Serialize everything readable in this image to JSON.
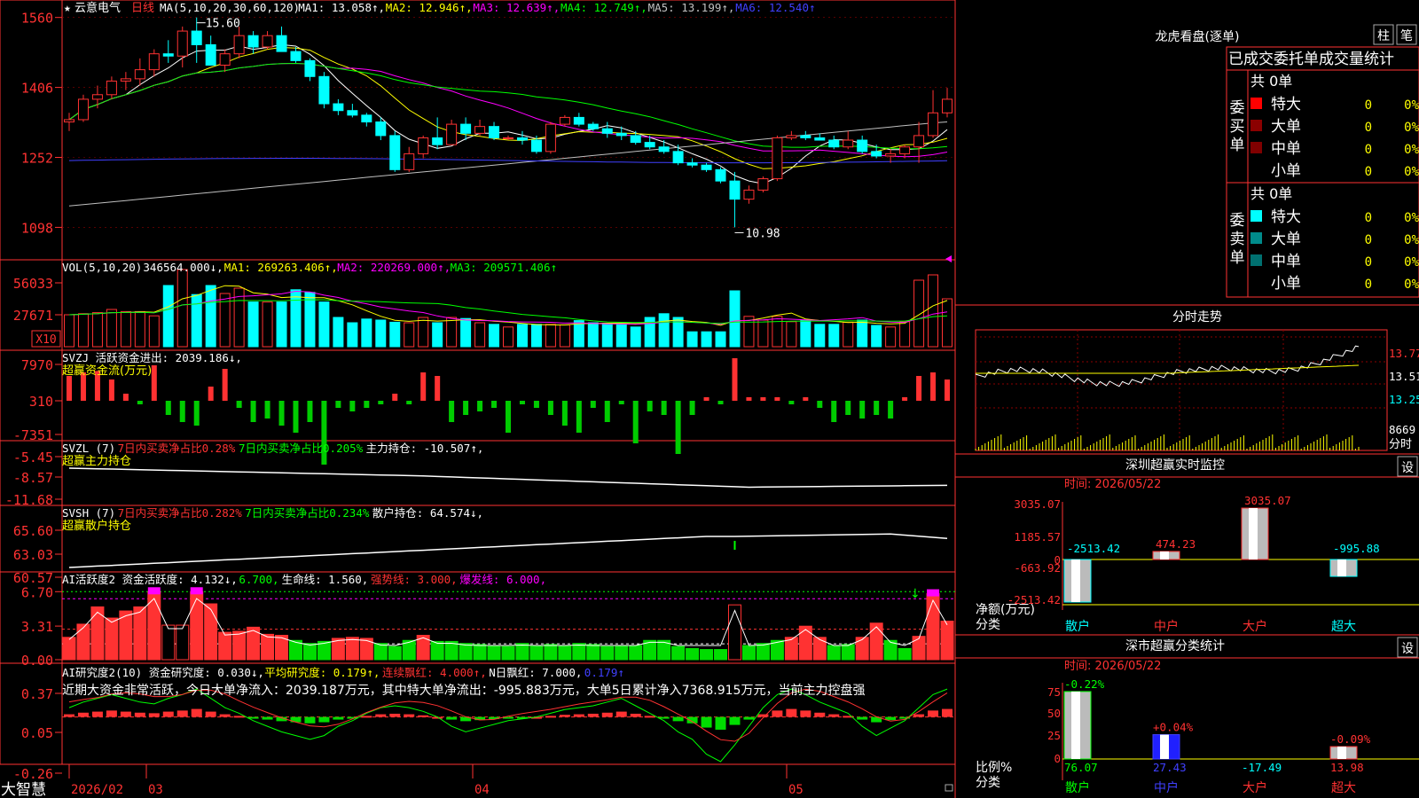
{
  "stock": {
    "star": "★",
    "name": "云意电气",
    "period": "日线"
  },
  "colors": {
    "up": "#ff3232",
    "down": "#00ffff",
    "ma1": "#ffffff",
    "ma2": "#ffff00",
    "ma3": "#ff00ff",
    "ma4": "#00ff00",
    "ma5": "#c0c0c0",
    "ma6": "#4040ff",
    "grid": "#8b0000",
    "axis": "#ff3232",
    "bg": "#000000"
  },
  "panels": {
    "kline": {
      "title_parts": [
        {
          "text": "MA(5,10,20,30,60,120)",
          "color": "#ffffff"
        },
        {
          "text": "MA1: 13.058↑,",
          "color": "#ffffff"
        },
        {
          "text": "MA2: 12.946↑,",
          "color": "#ffff00"
        },
        {
          "text": "MA3: 12.639↑,",
          "color": "#ff00ff"
        },
        {
          "text": "MA4: 12.749↑,",
          "color": "#00ff00"
        },
        {
          "text": "MA5: 13.199↑,",
          "color": "#c0c0c0"
        },
        {
          "text": "MA6: 12.540↑",
          "color": "#4040ff"
        }
      ],
      "y_ticks": [
        "1560",
        "1406",
        "1252",
        "1098"
      ],
      "y_range": [
        10.5,
        15.75
      ],
      "high_label": "15.60",
      "low_label": "10.98"
    },
    "vol": {
      "title_parts": [
        {
          "text": "VOL(5,10,20)",
          "color": "#ffffff"
        },
        {
          "text": "346564.000↓,",
          "color": "#ffffff"
        },
        {
          "text": "MA1: 269263.406↑,",
          "color": "#ffff00"
        },
        {
          "text": "MA2: 220269.000↑,",
          "color": "#ff00ff"
        },
        {
          "text": "MA3: 209571.406↑",
          "color": "#00ff00"
        }
      ],
      "y_ticks": [
        "56033",
        "27671"
      ],
      "unit": "X10"
    },
    "svzj": {
      "title_parts": [
        {
          "text": "SVZJ  活跃资金进出: 2039.186↓,",
          "color": "#ffffff"
        }
      ],
      "subtitle": "超赢资金流(万元)",
      "y_ticks": [
        "7970",
        "310",
        "-7351"
      ]
    },
    "svzl": {
      "title_parts": [
        {
          "text": "SVZL (7)",
          "color": "#ffffff"
        },
        {
          "text": "7日内买卖净占比0.28%",
          "color": "#ff3232"
        },
        {
          "text": "7日内买卖净占比0.205%",
          "color": "#00ff00"
        },
        {
          "text": "主力持仓: -10.507↑,",
          "color": "#ffffff"
        }
      ],
      "subtitle": "超赢主力持仓",
      "y_ticks": [
        "-5.45",
        "-8.57",
        "-11.68"
      ]
    },
    "svsh": {
      "title_parts": [
        {
          "text": "SVSH (7)",
          "color": "#ffffff"
        },
        {
          "text": "7日内买卖净占比0.282%",
          "color": "#ff3232"
        },
        {
          "text": "7日内买卖净占比0.234%",
          "color": "#00ff00"
        },
        {
          "text": "散户持仓: 64.574↓,",
          "color": "#ffffff"
        }
      ],
      "subtitle": "超赢散户持仓",
      "y_ticks": [
        "65.60",
        "63.03",
        "60.57"
      ]
    },
    "active": {
      "title_parts": [
        {
          "text": "AI活跃度2 资金活跃度: 4.132↓,",
          "color": "#ffffff"
        },
        {
          "text": "6.700,",
          "color": "#00ff00"
        },
        {
          "text": "生命线: 1.560,",
          "color": "#ffffff"
        },
        {
          "text": "强势线: 3.000,",
          "color": "#ff3232"
        },
        {
          "text": "爆发线: 6.000,",
          "color": "#ff00ff"
        }
      ],
      "y_ticks": [
        "6.70",
        "3.31",
        "0.00"
      ]
    },
    "research": {
      "title_parts": [
        {
          "text": "AI研究度2(10) 资金研究度: 0.030↓,",
          "color": "#ffffff"
        },
        {
          "text": "平均研究度: 0.179↑,",
          "color": "#ffff00"
        },
        {
          "text": "连续飘红: 4.000↑,",
          "color": "#ff3232"
        },
        {
          "text": "N日飘红: 7.000,",
          "color": "#ffffff"
        },
        {
          "text": "0.179↑",
          "color": "#4040ff"
        }
      ],
      "comment": "近期大资金非常活跃，今日大单净流入：2039.187万元，其中特大单净流出：-995.883万元，大单5日累计净入7368.915万元，当前主力控盘强",
      "y_ticks": [
        "0.37",
        "0.05",
        "-0.26"
      ]
    }
  },
  "x_axis": {
    "brand": "大智慧",
    "labels": [
      "2026/02",
      "03",
      "04",
      "05"
    ]
  },
  "right": {
    "lhb": {
      "title": "龙虎看盘(逐单)",
      "btn_bar": "柱",
      "btn_single": "笔",
      "header": "已成交委托单成交量统计"
    },
    "buy": {
      "vlabel": "委买单",
      "total": "共 0单",
      "rows": [
        {
          "name": "特大",
          "count": "0",
          "pct": "0%",
          "color": "#ff0000"
        },
        {
          "name": "大单",
          "count": "0",
          "pct": "0%",
          "color": "#8b0000"
        },
        {
          "name": "中单",
          "count": "0",
          "pct": "0%",
          "color": "#800000"
        },
        {
          "name": "小单",
          "count": "0",
          "pct": "0%",
          "color": "#000000"
        }
      ]
    },
    "sell": {
      "vlabel": "委卖单",
      "total": "共 0单",
      "rows": [
        {
          "name": "特大",
          "count": "0",
          "pct": "0%",
          "color": "#00ffff"
        },
        {
          "name": "大单",
          "count": "0",
          "pct": "0%",
          "color": "#008b8b"
        },
        {
          "name": "中单",
          "count": "0",
          "pct": "0%",
          "color": "#007070"
        },
        {
          "name": "小单",
          "count": "0",
          "pct": "0%",
          "color": "#000000"
        }
      ]
    },
    "intraday": {
      "title": "分时走势",
      "prices": [
        "13.77",
        "13.51",
        "13.25"
      ],
      "volume": "8669",
      "vol_label": "分时"
    },
    "monitor": {
      "title": "深圳超赢实时监控",
      "btn": "设",
      "time": "时间: 2026/05/22",
      "y_ticks": [
        "3035.07",
        "1185.57",
        "-663.92",
        "-2513.42"
      ],
      "axis_label": "净额(万元)",
      "axis_label2": "分类",
      "cats": [
        "散户",
        "中户",
        "大户",
        "超大"
      ],
      "values": [
        -2513.42,
        474.23,
        3035.07,
        -995.88
      ],
      "value_labels": [
        "-2513.42",
        "474.23",
        "3035.07",
        "-995.88"
      ],
      "zero": "0"
    },
    "classify": {
      "title": "深市超赢分类统计",
      "btn": "设",
      "time": "时间: 2026/05/22",
      "y_ticks": [
        "75",
        "50",
        "25",
        "0"
      ],
      "axis_label": "比例%",
      "axis_label2": "分类",
      "cats": [
        "散户",
        "中户",
        "大户",
        "超大"
      ],
      "values": [
        76.07,
        27.43,
        -17.49,
        13.98
      ],
      "value_labels": [
        "76.07",
        "27.43",
        "-17.49",
        "13.98"
      ],
      "changes": [
        "-0.22%",
        "+0.04%",
        "",
        "-0.09%"
      ]
    }
  },
  "chart_data": {
    "type": "candlestick",
    "title": "云意电气 日线",
    "ohlc": [
      [
        13.3,
        13.5,
        13.1,
        13.35
      ],
      [
        13.35,
        13.9,
        13.3,
        13.8
      ],
      [
        13.8,
        14.1,
        13.6,
        13.9
      ],
      [
        13.9,
        14.3,
        13.8,
        14.2
      ],
      [
        14.2,
        14.4,
        14.0,
        14.25
      ],
      [
        14.25,
        14.7,
        14.1,
        14.45
      ],
      [
        14.45,
        14.9,
        14.3,
        14.8
      ],
      [
        14.8,
        15.1,
        14.6,
        14.75
      ],
      [
        14.75,
        15.4,
        14.5,
        15.3
      ],
      [
        15.3,
        15.6,
        14.6,
        15.0
      ],
      [
        15.0,
        15.2,
        14.7,
        14.55
      ],
      [
        14.55,
        14.9,
        14.4,
        14.8
      ],
      [
        14.8,
        15.4,
        14.7,
        15.2
      ],
      [
        15.2,
        15.3,
        14.8,
        14.95
      ],
      [
        14.95,
        15.3,
        14.9,
        15.2
      ],
      [
        15.2,
        15.4,
        14.9,
        14.85
      ],
      [
        14.85,
        14.95,
        14.6,
        14.65
      ],
      [
        14.65,
        14.7,
        14.2,
        14.3
      ],
      [
        14.3,
        14.4,
        13.6,
        13.7
      ],
      [
        13.7,
        13.8,
        13.45,
        13.55
      ],
      [
        13.55,
        13.7,
        13.4,
        13.45
      ],
      [
        13.45,
        13.5,
        13.2,
        13.3
      ],
      [
        13.3,
        13.4,
        12.9,
        13.0
      ],
      [
        13.0,
        13.1,
        12.2,
        12.25
      ],
      [
        12.25,
        12.75,
        12.2,
        12.6
      ],
      [
        12.6,
        13.0,
        12.5,
        12.95
      ],
      [
        12.95,
        13.4,
        12.7,
        12.8
      ],
      [
        12.8,
        13.35,
        12.8,
        13.25
      ],
      [
        13.25,
        13.4,
        12.9,
        13.05
      ],
      [
        13.05,
        13.35,
        13.0,
        13.2
      ],
      [
        13.2,
        13.3,
        12.9,
        12.95
      ],
      [
        12.95,
        13.0,
        12.9,
        12.95
      ],
      [
        12.95,
        13.1,
        12.8,
        12.9
      ],
      [
        12.9,
        13.0,
        12.6,
        12.65
      ],
      [
        12.65,
        13.3,
        12.6,
        13.25
      ],
      [
        13.25,
        13.45,
        13.2,
        13.4
      ],
      [
        13.4,
        13.5,
        13.2,
        13.25
      ],
      [
        13.25,
        13.3,
        13.1,
        13.15
      ],
      [
        13.15,
        13.3,
        12.95,
        13.05
      ],
      [
        13.05,
        13.2,
        12.9,
        13.0
      ],
      [
        13.0,
        13.1,
        12.8,
        12.85
      ],
      [
        12.85,
        13.0,
        12.7,
        12.75
      ],
      [
        12.75,
        12.9,
        12.6,
        12.65
      ],
      [
        12.65,
        12.8,
        12.35,
        12.4
      ],
      [
        12.4,
        12.5,
        12.3,
        12.35
      ],
      [
        12.35,
        12.4,
        12.2,
        12.25
      ],
      [
        12.25,
        12.3,
        11.95,
        12.0
      ],
      [
        12.0,
        12.2,
        10.98,
        11.6
      ],
      [
        11.6,
        11.9,
        11.5,
        11.8
      ],
      [
        11.8,
        12.1,
        11.75,
        12.05
      ],
      [
        12.05,
        13.0,
        12.0,
        12.95
      ],
      [
        12.95,
        13.1,
        12.9,
        13.0
      ],
      [
        13.0,
        13.1,
        12.9,
        12.95
      ],
      [
        12.95,
        13.05,
        12.9,
        12.9
      ],
      [
        12.9,
        13.0,
        12.7,
        12.75
      ],
      [
        12.75,
        13.1,
        12.7,
        12.9
      ],
      [
        12.9,
        13.0,
        12.6,
        12.65
      ],
      [
        12.65,
        12.8,
        12.5,
        12.55
      ],
      [
        12.55,
        12.7,
        12.4,
        12.6
      ],
      [
        12.6,
        12.8,
        12.5,
        12.75
      ],
      [
        12.75,
        13.3,
        12.4,
        13.0
      ],
      [
        13.0,
        14.0,
        12.95,
        13.5
      ],
      [
        13.5,
        14.05,
        13.4,
        13.8
      ]
    ],
    "volume_rel": [
      0.6,
      0.62,
      0.64,
      0.7,
      0.66,
      0.66,
      0.58,
      1.15,
      1.45,
      0.98,
      1.15,
      1.0,
      1.1,
      0.84,
      0.84,
      0.84,
      1.07,
      1.02,
      0.84,
      0.55,
      0.45,
      0.52,
      0.5,
      0.46,
      0.45,
      0.55,
      0.45,
      0.55,
      0.53,
      0.45,
      0.42,
      0.37,
      0.42,
      0.42,
      0.42,
      0.41,
      0.49,
      0.45,
      0.44,
      0.42,
      0.37,
      0.55,
      0.62,
      0.55,
      0.28,
      0.28,
      0.28,
      1.05,
      0.57,
      0.5,
      0.57,
      0.47,
      0.5,
      0.42,
      0.42,
      0.46,
      0.5,
      0.4,
      0.37,
      0.47,
      1.25,
      1.35,
      0.9
    ],
    "svzj": [
      0.35,
      0.4,
      0.42,
      0.3,
      0.1,
      -0.05,
      0.5,
      -0.2,
      -0.3,
      -0.35,
      0.2,
      0.45,
      -0.1,
      -0.3,
      -0.25,
      -0.35,
      -0.45,
      -0.3,
      -0.9,
      -0.1,
      -0.15,
      -0.1,
      -0.05,
      0.1,
      -0.05,
      0.4,
      0.35,
      -0.3,
      -0.2,
      -0.15,
      -0.1,
      -0.45,
      -0.05,
      -0.1,
      -0.2,
      -0.35,
      -0.45,
      -0.1,
      -0.3,
      -0.05,
      -0.6,
      -0.15,
      -0.2,
      -0.75,
      -0.2,
      0.05,
      -0.05,
      0.6,
      0.05,
      0.05,
      0.05,
      -0.05,
      0.05,
      -0.1,
      -0.3,
      -0.2,
      -0.25,
      -0.2,
      -0.25,
      0.05,
      0.35,
      0.4,
      0.3
    ],
    "active": [
      2.2,
      3.5,
      5.2,
      4.1,
      4.8,
      5.2,
      6.7,
      3.4,
      3.4,
      6.7,
      5.5,
      2.7,
      2.8,
      3.2,
      2.5,
      2.4,
      1.9,
      1.6,
      1.8,
      2.1,
      2.2,
      2.1,
      1.6,
      1.3,
      1.9,
      2.4,
      1.8,
      1.8,
      1.6,
      1.5,
      1.4,
      1.3,
      1.6,
      1.4,
      1.5,
      1.4,
      1.6,
      1.5,
      1.3,
      1.4,
      1.4,
      1.9,
      1.9,
      1.3,
      1.1,
      1.0,
      1.0,
      5.4,
      1.4,
      1.6,
      1.9,
      2.2,
      3.3,
      2.2,
      1.4,
      1.5,
      2.2,
      3.6,
      1.9,
      1.1,
      2.3,
      6.5,
      3.8
    ],
    "research": [
      0.05,
      0.08,
      0.1,
      0.12,
      0.1,
      0.08,
      0.07,
      0.1,
      0.12,
      0.15,
      0.1,
      0.05,
      0.02,
      -0.02,
      -0.05,
      -0.08,
      -0.1,
      -0.12,
      -0.1,
      -0.05,
      -0.02,
      0.02,
      0.05,
      0.06,
      0.05,
      0.03,
      0.0,
      -0.05,
      -0.08,
      -0.06,
      -0.04,
      -0.02,
      -0.01,
      0.0,
      0.02,
      0.04,
      0.05,
      0.06,
      0.08,
      0.1,
      0.06,
      0.02,
      -0.02,
      -0.08,
      -0.12,
      -0.2,
      -0.24,
      -0.15,
      -0.05,
      0.05,
      0.12,
      0.15,
      0.12,
      0.08,
      0.05,
      0.02,
      -0.05,
      -0.1,
      -0.06,
      -0.02,
      0.05,
      0.12,
      0.15
    ]
  }
}
